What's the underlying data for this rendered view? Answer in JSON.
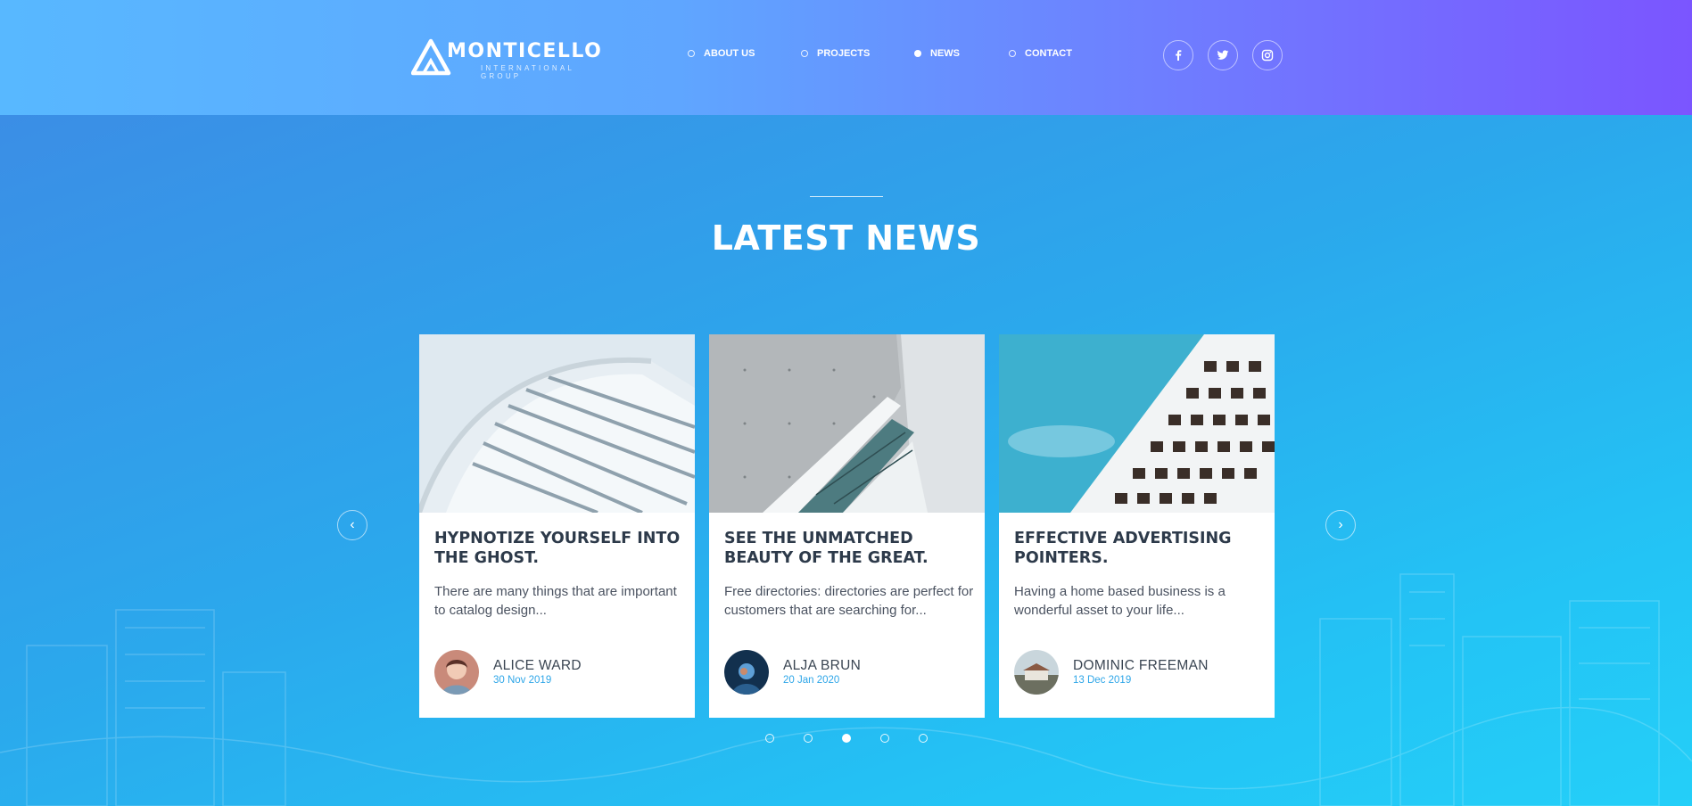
{
  "brand": {
    "name": "MONTICELLO",
    "tagline": "INTERNATIONAL GROUP"
  },
  "nav": {
    "items": [
      {
        "label": "ABOUT US",
        "active": false
      },
      {
        "label": "PROJECTS",
        "active": false
      },
      {
        "label": "NEWS",
        "active": true
      },
      {
        "label": "CONTACT",
        "active": false
      }
    ]
  },
  "social": [
    {
      "icon": "facebook-icon",
      "glyph": "f"
    },
    {
      "icon": "twitter-icon",
      "glyph": "t"
    },
    {
      "icon": "instagram-icon",
      "glyph": "i"
    }
  ],
  "section": {
    "title": "LATEST NEWS"
  },
  "carousel": {
    "prev_glyph": "‹",
    "next_glyph": "›",
    "dots": 5,
    "active_dot": 3
  },
  "cards": [
    {
      "title": "HYPNOTIZE YOURSELF INTO THE GHOST.",
      "excerpt": "There are many things that are important to catalog design...",
      "author": "ALICE WARD",
      "date": "30 Nov 2019"
    },
    {
      "title": "SEE THE UNMATCHED BEAUTY OF THE GREAT.",
      "excerpt": "Free directories: directories are perfect for customers that are searching for...",
      "author": "ALJA BRUN",
      "date": "20 Jan 2020"
    },
    {
      "title": "EFFECTIVE ADVERTISING POINTERS.",
      "excerpt": "Having a home based business is a wonderful asset to your life...",
      "author": "DOMINIC FREEMAN",
      "date": "13 Dec 2019"
    }
  ],
  "colors": {
    "accent": "#2ea6e8",
    "heading": "#2d3a4a",
    "header_start": "#58b8ff",
    "header_end": "#7b55ff"
  }
}
